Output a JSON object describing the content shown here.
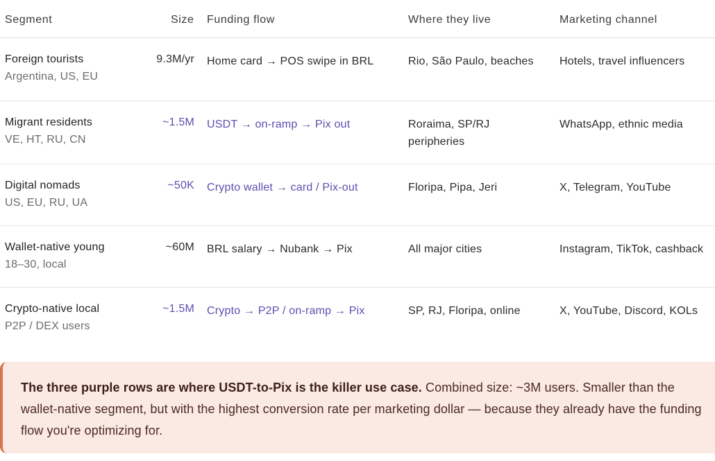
{
  "headers": {
    "segment": "Segment",
    "size": "Size",
    "funding": "Funding flow",
    "where": "Where they live",
    "marketing": "Marketing channel"
  },
  "rows": [
    {
      "name": "Foreign tourists",
      "sub": "Argentina, US, EU",
      "size": "9.3M/yr",
      "funding": "Home card → POS swipe in BRL",
      "where": [
        "Rio, São Paulo, beaches"
      ],
      "marketing": "Hotels, travel influencers",
      "highlighted": false
    },
    {
      "name": "Migrant residents",
      "sub": "VE, HT, RU, CN",
      "size": "~1.5M",
      "funding": "USDT → on-ramp → Pix out",
      "where": [
        "Roraima, SP/RJ",
        "peripheries"
      ],
      "marketing": "WhatsApp, ethnic media",
      "highlighted": true
    },
    {
      "name": "Digital nomads",
      "sub": "US, EU, RU, UA",
      "size": "~50K",
      "funding": "Crypto wallet → card / Pix-out",
      "where": [
        "Floripa, Pipa, Jeri"
      ],
      "marketing": "X, Telegram, YouTube",
      "highlighted": true
    },
    {
      "name": "Wallet-native young",
      "sub": "18–30, local",
      "size": "~60M",
      "funding": "BRL salary → Nubank → Pix",
      "where": [
        "All major cities"
      ],
      "marketing": "Instagram, TikTok, cashback",
      "highlighted": false
    },
    {
      "name": "Crypto-native local",
      "sub": "P2P / DEX users",
      "size": "~1.5M",
      "funding": "Crypto → P2P / on-ramp → Pix",
      "where": [
        "SP, RJ, Floripa, online"
      ],
      "marketing": "X, YouTube, Discord, KOLs",
      "highlighted": true
    }
  ],
  "callout": {
    "bold": "The three purple rows are where USDT-to-Pix is the killer use case.",
    "rest": " Combined size: ~3M users. Smaller than the wallet-native segment, but with the highest conversion rate per marketing dollar — because they already have the funding flow you're optimizing for."
  },
  "colors": {
    "highlight_purple": "#5a4fb0",
    "callout_bg": "#fbe9e4",
    "callout_border": "#d9744f"
  }
}
